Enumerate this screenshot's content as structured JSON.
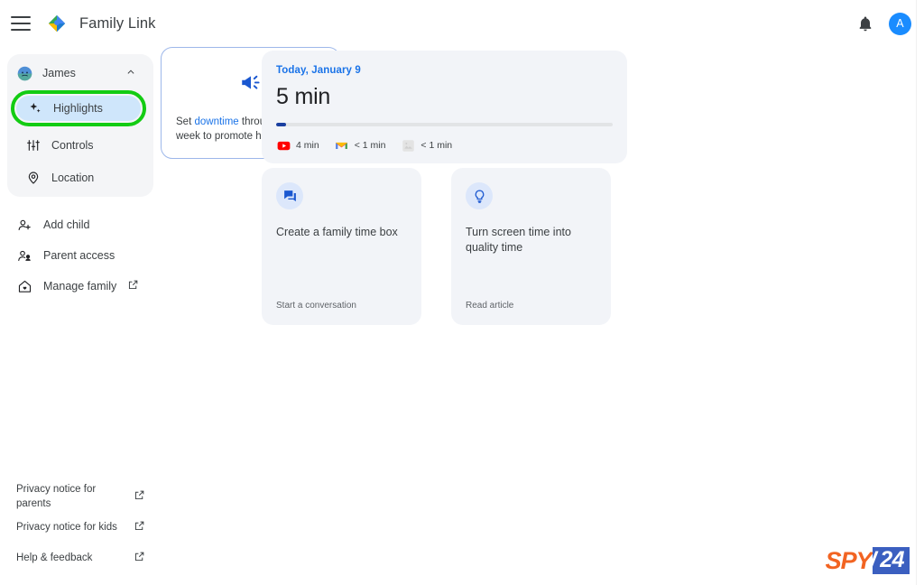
{
  "header": {
    "menu_icon": "hamburger-menu-icon",
    "logo_icon": "family-link-logo-icon",
    "title": "Family Link",
    "notifications_icon": "bell-icon",
    "avatar_initial": "A"
  },
  "sidebar": {
    "profile": {
      "name": "James",
      "avatar_icon": "child-avatar-icon",
      "chevron_icon": "chevron-up-icon"
    },
    "nav_items": [
      {
        "label": "Highlights",
        "icon": "sparkle-icon",
        "selected": true
      },
      {
        "label": "Controls",
        "icon": "tune-sliders-icon",
        "selected": false
      },
      {
        "label": "Location",
        "icon": "map-pin-icon",
        "selected": false
      }
    ],
    "secondary_items": [
      {
        "label": "Add child",
        "icon": "person-add-icon",
        "external": false
      },
      {
        "label": "Parent access",
        "icon": "people-icon",
        "external": false
      },
      {
        "label": "Manage family",
        "icon": "home-heart-icon",
        "external": true
      }
    ],
    "footer_items": [
      {
        "label": "Privacy notice for parents",
        "icon": "external-link-icon"
      },
      {
        "label": "Privacy notice for kids",
        "icon": "external-link-icon"
      },
      {
        "label": "Help & feedback",
        "icon": "external-link-icon"
      }
    ]
  },
  "main": {
    "screen_time_card": {
      "date": "Today, January 9",
      "total": "5 min",
      "progress_percent": 3,
      "apps": [
        {
          "name": "YouTube",
          "icon": "youtube-icon",
          "time": "4 min"
        },
        {
          "name": "Gmail",
          "icon": "gmail-icon",
          "time": "< 1 min"
        },
        {
          "name": "Other app",
          "icon": "generic-app-icon",
          "time": "< 1 min"
        }
      ]
    },
    "downtime_card": {
      "icon": "campaign-megaphone-icon",
      "text_before": "Set ",
      "link": "downtime",
      "text_after": " throughout the week to promote healthy habits"
    },
    "promo_cards": [
      {
        "icon": "chat-forum-icon",
        "title": "Create a family time box",
        "action": "Start a conversation"
      },
      {
        "icon": "lightbulb-icon",
        "title": "Turn screen time into quality time",
        "action": "Read article"
      }
    ]
  },
  "watermark": {
    "brand": "SPY",
    "slash": "/",
    "number": "24"
  },
  "colors": {
    "accent_blue": "#1a73e8",
    "highlight_ring_green": "#13cc13",
    "selected_pill_blue": "#cfe6fb",
    "card_bg": "#f2f4f8",
    "progress_fill": "#1a3fa0"
  }
}
